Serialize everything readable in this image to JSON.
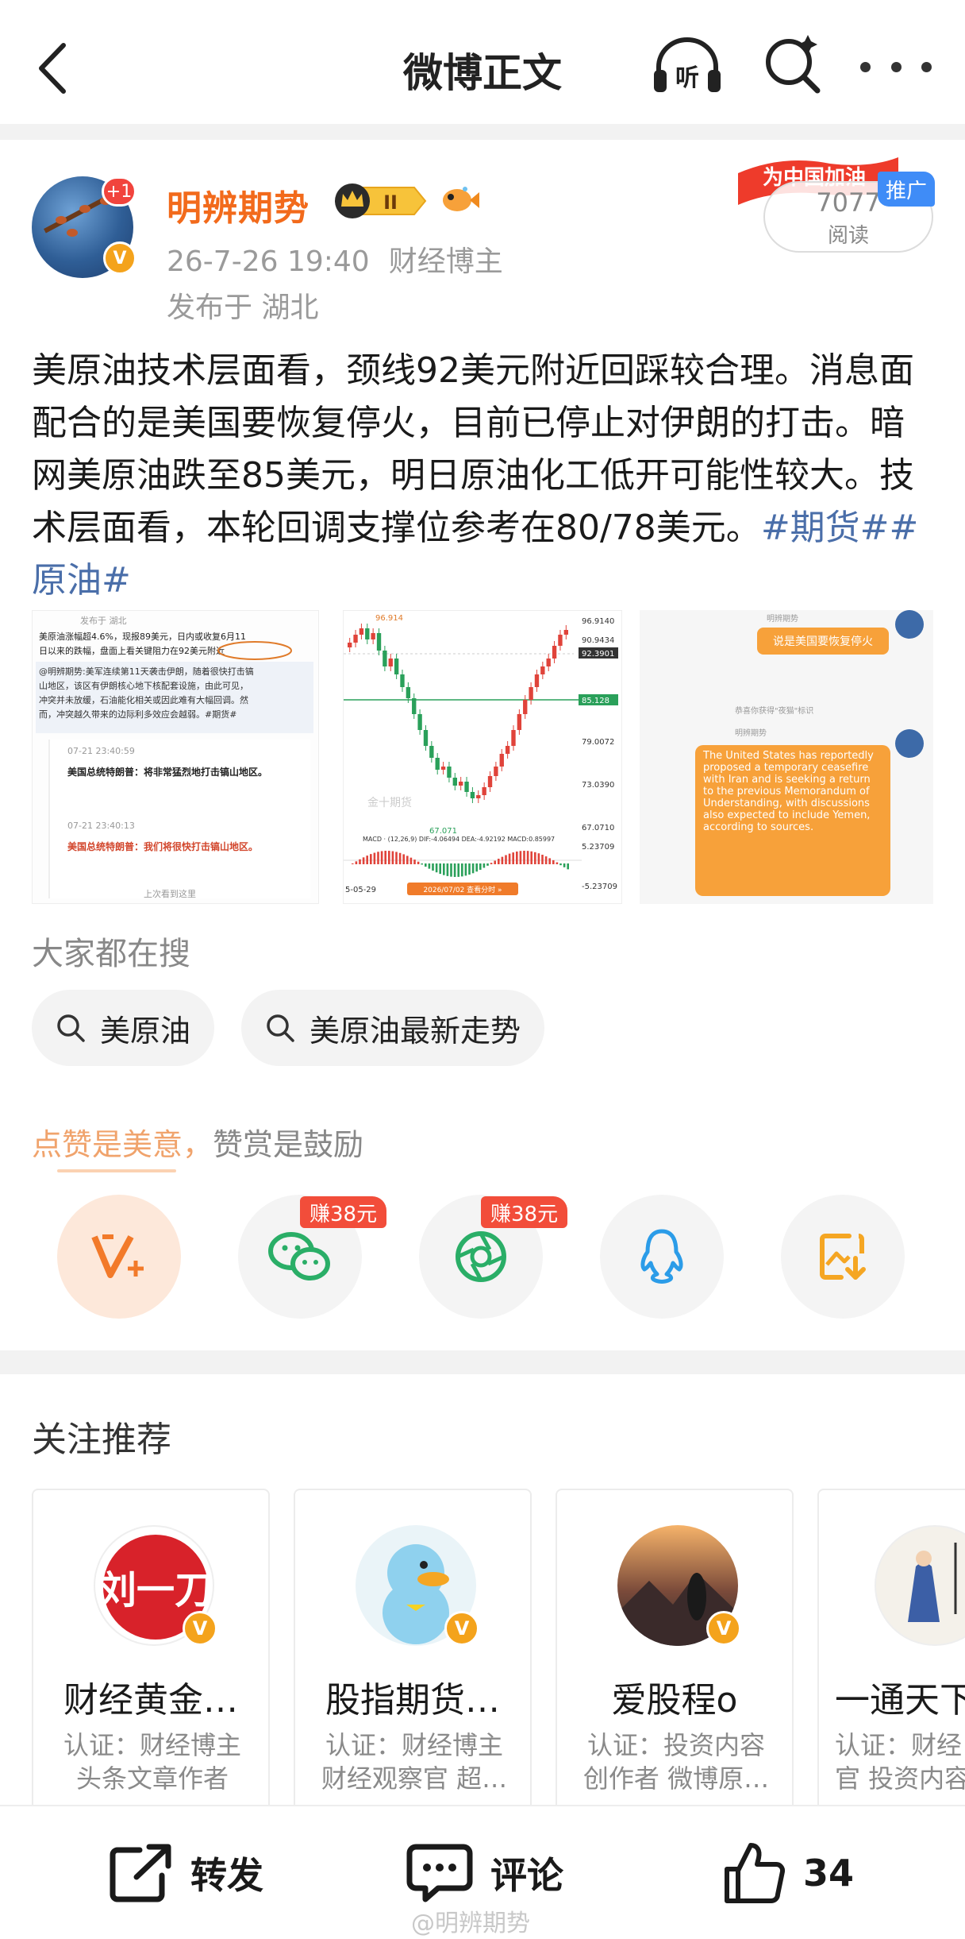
{
  "nav": {
    "title": "微博正文",
    "listen_glyph": "听"
  },
  "author": {
    "name": "明辨期势",
    "plus_badge": "+1",
    "verified_glyph": "V",
    "level_badge": "II",
    "time": "26-7-26 19:40",
    "role": "财经博主",
    "location": "发布于 湖北"
  },
  "promo": {
    "banner_text": "为中国加油",
    "tag": "推广",
    "reads_count": "7077",
    "reads_label": "阅读"
  },
  "post": {
    "text_main": "美原油技术层面看，颈线92美元附近回踩较合理。消息面配合的是美国要恢复停火，目前已停止对伊朗的打击。暗网美原油跌至85美元，明日原油化工低开可能性较大。技术层面看，本轮回调支撑位参考在80/78美元。",
    "tag1": "#期货#",
    "tag2": "#原油#"
  },
  "image1": {
    "header": "发布于 湖北",
    "line1": "美原油涨幅超4.6%，现报89美元，日内或收复6月11",
    "line2": "日以来的跌幅，盘面上看关键阻力在92美元附近",
    "line3": "@明辨期势:美军连续第11天袭击伊朗，随着很快打击镐",
    "line4": "山地区，该区有伊朗核心地下核配套设施，由此可见，",
    "line5": "冲突并未放缓，石油能化相关或因此难有大幅回调。然",
    "line6": "而，冲突越久带来的边际利多效应会越弱。#期货#",
    "t1": "07-21 23:40:59",
    "n1": "美国总统特朗普：将非常猛烈地打击镐山地区。",
    "t2": "07-21 23:40:13",
    "n2": "美国总统特朗普：我们将很快打击镐山地区。",
    "footer": "上次看到这里"
  },
  "image2": {
    "top_price": "96.914",
    "p1": "96.9140",
    "p2": "90.9434",
    "p3": "92.3901",
    "p4": "85.128",
    "p5": "79.0072",
    "p6": "73.0390",
    "p7": "67.0710",
    "low": "67.071",
    "macd": "MACD · (12,26,9)  DIF:-4.06494 DEA:-4.92192 MACD:0.85997",
    "m1": "5.23709",
    "m2": "-5.23709",
    "date_left": "5-05-29",
    "date_mid": "2026/07/02 查看分时 »",
    "watermark": "金十期货"
  },
  "image3": {
    "user": "明辨期势",
    "bubble1": "说是美国要恢复停火",
    "notice": "恭喜你获得\"夜猫\"标识",
    "bubble2": "The United States has reportedly proposed a temporary ceasefire with Iran and is seeking a return to the previous Memorandum of Understanding, with discussions also expected to include Yemen, according to sources."
  },
  "search": {
    "heading": "大家都在搜",
    "chips": [
      "美原油",
      "美原油最新走势"
    ]
  },
  "reward": {
    "heading_part1": "点赞是美意，",
    "heading_part2": "赞赏是鼓励",
    "earn1": "赚38元",
    "earn2": "赚38元"
  },
  "recommend": {
    "heading": "关注推荐",
    "cards": [
      {
        "name": "财经黄金…",
        "desc1": "认证：财经博主",
        "desc2": "头条文章作者",
        "avatar_text": "刘一刀"
      },
      {
        "name": "股指期货…",
        "desc1": "认证：财经博主",
        "desc2": "财经观察官 超…"
      },
      {
        "name": "爱股程o",
        "desc1": "认证：投资内容",
        "desc2": "创作者 微博原…"
      },
      {
        "name": "一通天下",
        "desc1": "认证：财经",
        "desc2": "官 投资内容"
      }
    ]
  },
  "bottom": {
    "repost": "转发",
    "comment": "评论",
    "likes": "34",
    "watermark": "@明辨期势"
  },
  "colors": {
    "brand_orange": "#f26a1b",
    "tag_blue": "#4a6ea9",
    "badge_red": "#f24d3a",
    "verified": "#f4a31c"
  }
}
